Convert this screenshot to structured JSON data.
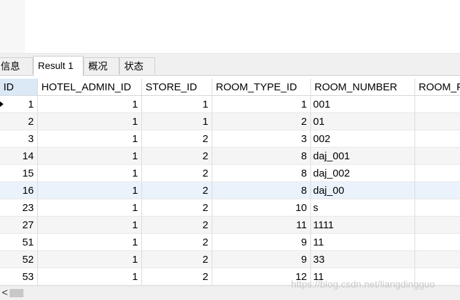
{
  "tabs": [
    {
      "label": "信息"
    },
    {
      "label": "Result 1"
    },
    {
      "label": "概况"
    },
    {
      "label": "状态"
    }
  ],
  "columns": [
    "ID",
    "HOTEL_ADMIN_ID",
    "STORE_ID",
    "ROOM_TYPE_ID",
    "ROOM_NUMBER",
    "ROOM_F"
  ],
  "rows": [
    [
      "1",
      "1",
      "1",
      "1",
      "001",
      ""
    ],
    [
      "2",
      "1",
      "1",
      "2",
      "01",
      ""
    ],
    [
      "3",
      "1",
      "2",
      "3",
      "002",
      ""
    ],
    [
      "14",
      "1",
      "2",
      "8",
      "daj_001",
      ""
    ],
    [
      "15",
      "1",
      "2",
      "8",
      "daj_002",
      ""
    ],
    [
      "16",
      "1",
      "2",
      "8",
      "daj_00",
      ""
    ],
    [
      "23",
      "1",
      "2",
      "10",
      "s",
      ""
    ],
    [
      "27",
      "1",
      "2",
      "11",
      "1111",
      ""
    ],
    [
      "51",
      "1",
      "2",
      "9",
      "11",
      ""
    ],
    [
      "52",
      "1",
      "2",
      "9",
      "33",
      ""
    ],
    [
      "53",
      "1",
      "2",
      "12",
      "11",
      ""
    ]
  ],
  "scroll_left_glyph": "<",
  "watermark": "https://blog.csdn.net/liangdingguo"
}
